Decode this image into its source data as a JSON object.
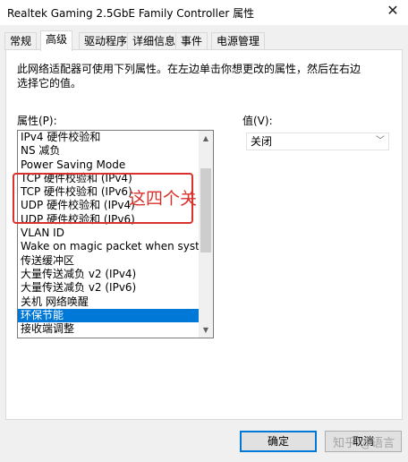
{
  "window": {
    "title": "Realtek Gaming 2.5GbE Family Controller 属性",
    "close_glyph": "✕"
  },
  "tabs": [
    {
      "label": "常规"
    },
    {
      "label": "高级"
    },
    {
      "label": "驱动程序"
    },
    {
      "label": "详细信息"
    },
    {
      "label": "事件"
    },
    {
      "label": "电源管理"
    }
  ],
  "active_tab": "高级",
  "panel": {
    "description": "此网络适配器可使用下列属性。在左边单击你想更改的属性，然后在右边选择它的值。",
    "property_label": "属性(P):",
    "value_label": "值(V):",
    "properties": [
      "IPv4 硬件校验和",
      "NS 减负",
      "Power Saving Mode",
      "TCP 硬件校验和 (IPv4)",
      "TCP 硬件校验和 (IPv6)",
      "UDP 硬件校验和 (IPv4)",
      "UDP 硬件校验和 (IPv6)",
      "VLAN ID",
      "Wake on magic packet when system",
      "传送缓冲区",
      "大量传送减负 v2 (IPv4)",
      "大量传送减负 v2 (IPv6)",
      "关机 网络唤醒",
      "环保节能",
      "接收端调整"
    ],
    "selected_property": "环保节能",
    "value_selected": "关闭"
  },
  "annotation": {
    "text": "这四个关",
    "color": "#d9312b"
  },
  "buttons": {
    "ok": "确定",
    "cancel": "取消"
  },
  "watermark": "知乎 @语言",
  "colors": {
    "selection": "#0078d7",
    "annotation": "#d9312b"
  }
}
